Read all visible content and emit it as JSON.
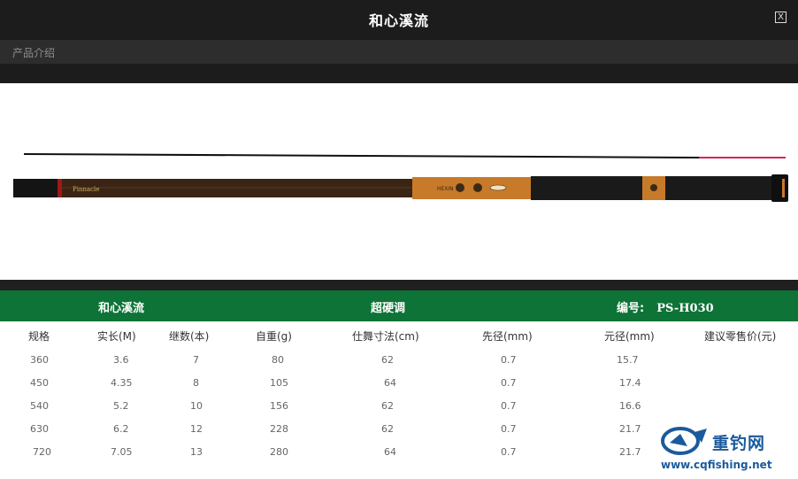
{
  "window": {
    "title": "和心溪流",
    "close_label": "X"
  },
  "section": {
    "label": "产品介绍"
  },
  "product_bar": {
    "name": "和心溪流",
    "action": "超硬调",
    "model_label": "编号:",
    "model": "PS-H030"
  },
  "rod_labels": {
    "brand": "Pinnacle",
    "grip": "HEXIN"
  },
  "table": {
    "headers": [
      "规格",
      "实长(M)",
      "继数(本)",
      "自重(g)",
      "仕舞寸法(cm)",
      "先径(mm)",
      "元径(mm)",
      "建议零售价(元)"
    ],
    "rows": [
      [
        "360",
        "3.6",
        "7",
        "80",
        "62",
        "0.7",
        "15.7",
        ""
      ],
      [
        "450",
        "4.35",
        "8",
        "105",
        "64",
        "0.7",
        "17.4",
        ""
      ],
      [
        "540",
        "5.2",
        "10",
        "156",
        "62",
        "0.7",
        "16.6",
        ""
      ],
      [
        "630",
        "6.2",
        "12",
        "228",
        "62",
        "0.7",
        "21.7",
        ""
      ],
      [
        "720",
        "7.05",
        "13",
        "280",
        "64",
        "0.7",
        "21.7",
        ""
      ]
    ]
  },
  "watermark": {
    "logo": "重钓网",
    "url": "www.cqfishing.net"
  },
  "colors": {
    "title_bar": "#1c1c1c",
    "product_bar": "#0d7336",
    "rod_gold": "#c77a2a",
    "tip_red": "#d6245a"
  }
}
